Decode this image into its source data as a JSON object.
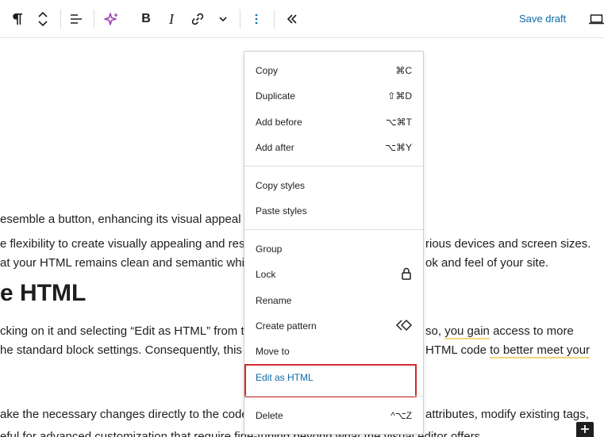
{
  "toolbar": {
    "save_label": "Save draft"
  },
  "content": {
    "line1": "esemble a button, enhancing its visual appeal a",
    "line2_left": "e flexibility to create visually appealing and resp",
    "line2_right": "rious devices and screen sizes.",
    "line3_left": "at your HTML remains clean and semantic while",
    "line3_right": "ok and feel of your site.",
    "heading": "e HTML",
    "line4_left": "cking on it and selecting “Edit as HTML” from th",
    "line4_right_pre": "so, ",
    "line4_right_hl": "you gain",
    "line4_right_post": " access to more",
    "line5_left": "he standard block settings. Consequently, this f",
    "line5_right_pre": "HTML code ",
    "line5_right_hl": "to better meet your",
    "line6_left": "ake the necessary changes directly to the code.",
    "line6_right": "attributes, modify existing tags,",
    "line7_left": "eful for advanced customization that require fine-tuning beyond what the visual editor offers."
  },
  "menu": {
    "items": [
      {
        "label": "Copy",
        "shortcut": "⌘C"
      },
      {
        "label": "Duplicate",
        "shortcut": "⇧⌘D"
      },
      {
        "label": "Add before",
        "shortcut": "⌥⌘T"
      },
      {
        "label": "Add after",
        "shortcut": "⌥⌘Y"
      },
      {
        "label": "Copy styles",
        "shortcut": ""
      },
      {
        "label": "Paste styles",
        "shortcut": ""
      },
      {
        "label": "Group",
        "shortcut": ""
      },
      {
        "label": "Lock",
        "shortcut": ""
      },
      {
        "label": "Rename",
        "shortcut": ""
      },
      {
        "label": "Create pattern",
        "shortcut": ""
      },
      {
        "label": "Move to",
        "shortcut": ""
      },
      {
        "label": "Edit as HTML",
        "shortcut": ""
      },
      {
        "label": "Delete",
        "shortcut": "^⌥Z"
      }
    ]
  },
  "colors": {
    "accent": "#0c6ba5",
    "ai_icon": "#a23ab7",
    "focus_outline": "#d12c2c",
    "highlight_underline": "#f6d77a"
  },
  "icons": [
    "paragraph-icon",
    "chevron-up-icon",
    "chevron-down-icon",
    "align-left-icon",
    "ai-sparkle-icon",
    "bold-icon",
    "italic-icon",
    "link-icon",
    "more-chevron-down-icon",
    "more-vertical-icon",
    "collapse-icon",
    "desktop-preview-icon",
    "lock-icon",
    "pattern-icon",
    "plus-icon"
  ]
}
